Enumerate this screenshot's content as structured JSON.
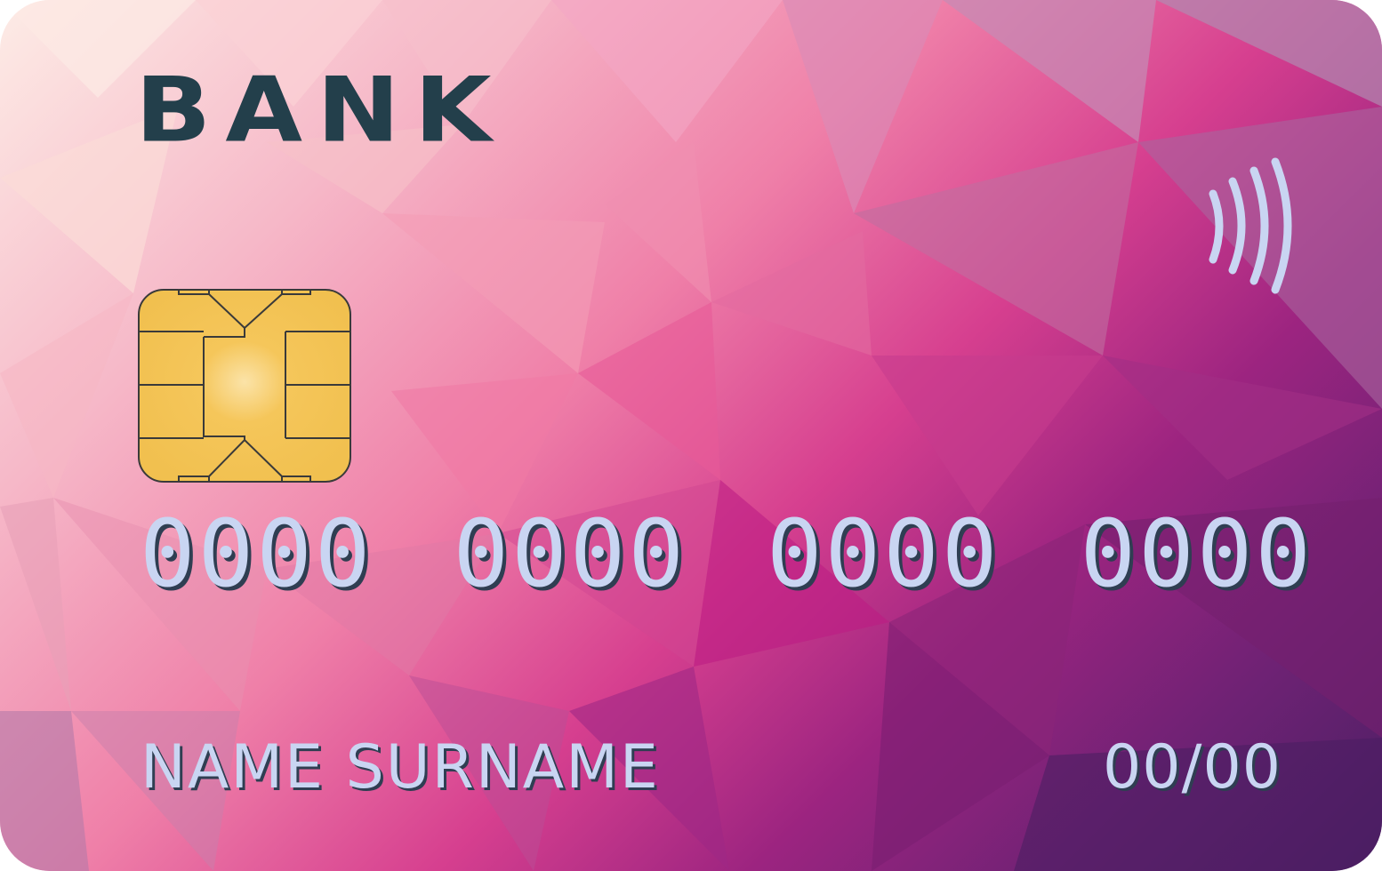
{
  "card": {
    "bank_name": "BANK",
    "number_groups": [
      "0000",
      "0000",
      "0000",
      "0000"
    ],
    "holder_name": "NAME SURNAME",
    "expiry": "00/00"
  },
  "icons": {
    "chip": "emv-chip-icon",
    "contactless": "contactless-payment-icon"
  },
  "colors": {
    "bank_text": "#233f4b",
    "embossed_text": "#c9d5f2",
    "chip_gold": "#f3c455",
    "contactless": "#c9d5f2"
  }
}
